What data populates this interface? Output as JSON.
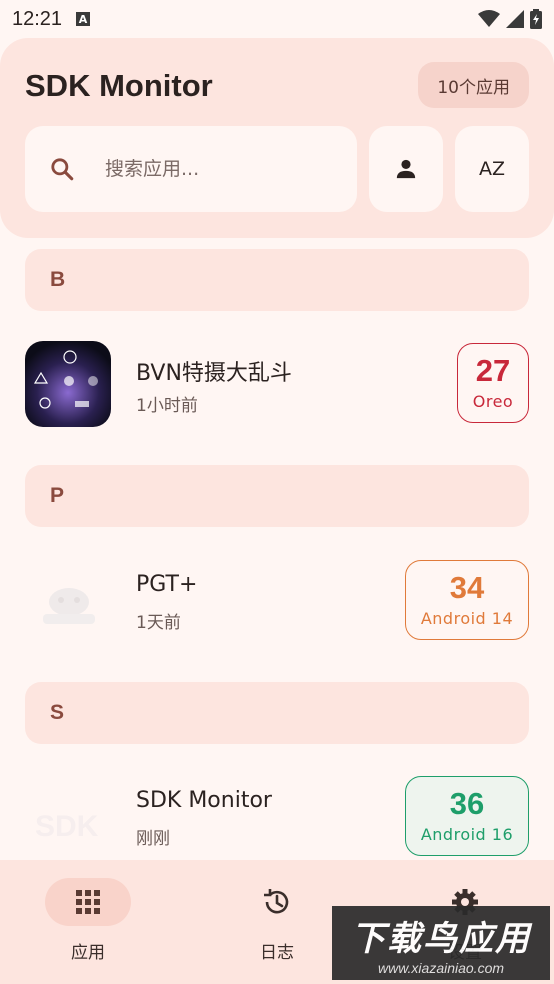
{
  "status_bar": {
    "time": "12:21"
  },
  "header": {
    "title": "SDK Monitor",
    "count_chip": "10个应用",
    "search_placeholder": "搜索应用...",
    "sort_label": "AZ"
  },
  "sections": [
    {
      "letter": "B",
      "apps": [
        {
          "name": "BVN特摄大乱斗",
          "time": "1小时前",
          "sdk": "27",
          "version": "Oreo",
          "color": "#c8283a",
          "bg": "#fff6f3"
        }
      ]
    },
    {
      "letter": "P",
      "apps": [
        {
          "name": "PGT+",
          "time": "1天前",
          "sdk": "34",
          "version": "Android 14",
          "color": "#e07a3a",
          "bg": "#fff6f3"
        }
      ]
    },
    {
      "letter": "S",
      "apps": [
        {
          "name": "SDK Monitor",
          "time": "刚刚",
          "sdk": "36",
          "version": "Android 16",
          "color": "#1e9e6a",
          "bg": "#eef4ee"
        }
      ]
    }
  ],
  "bottom_nav": {
    "apps_label": "应用",
    "log_label": "日志",
    "settings_label": "设置"
  },
  "watermark": {
    "big": "下载鸟应用",
    "small": "www.xiazainiao.com"
  },
  "colors": {
    "accent": "#8a4a3e",
    "header_bg": "#fde5df",
    "page_bg": "#fff6f3"
  }
}
